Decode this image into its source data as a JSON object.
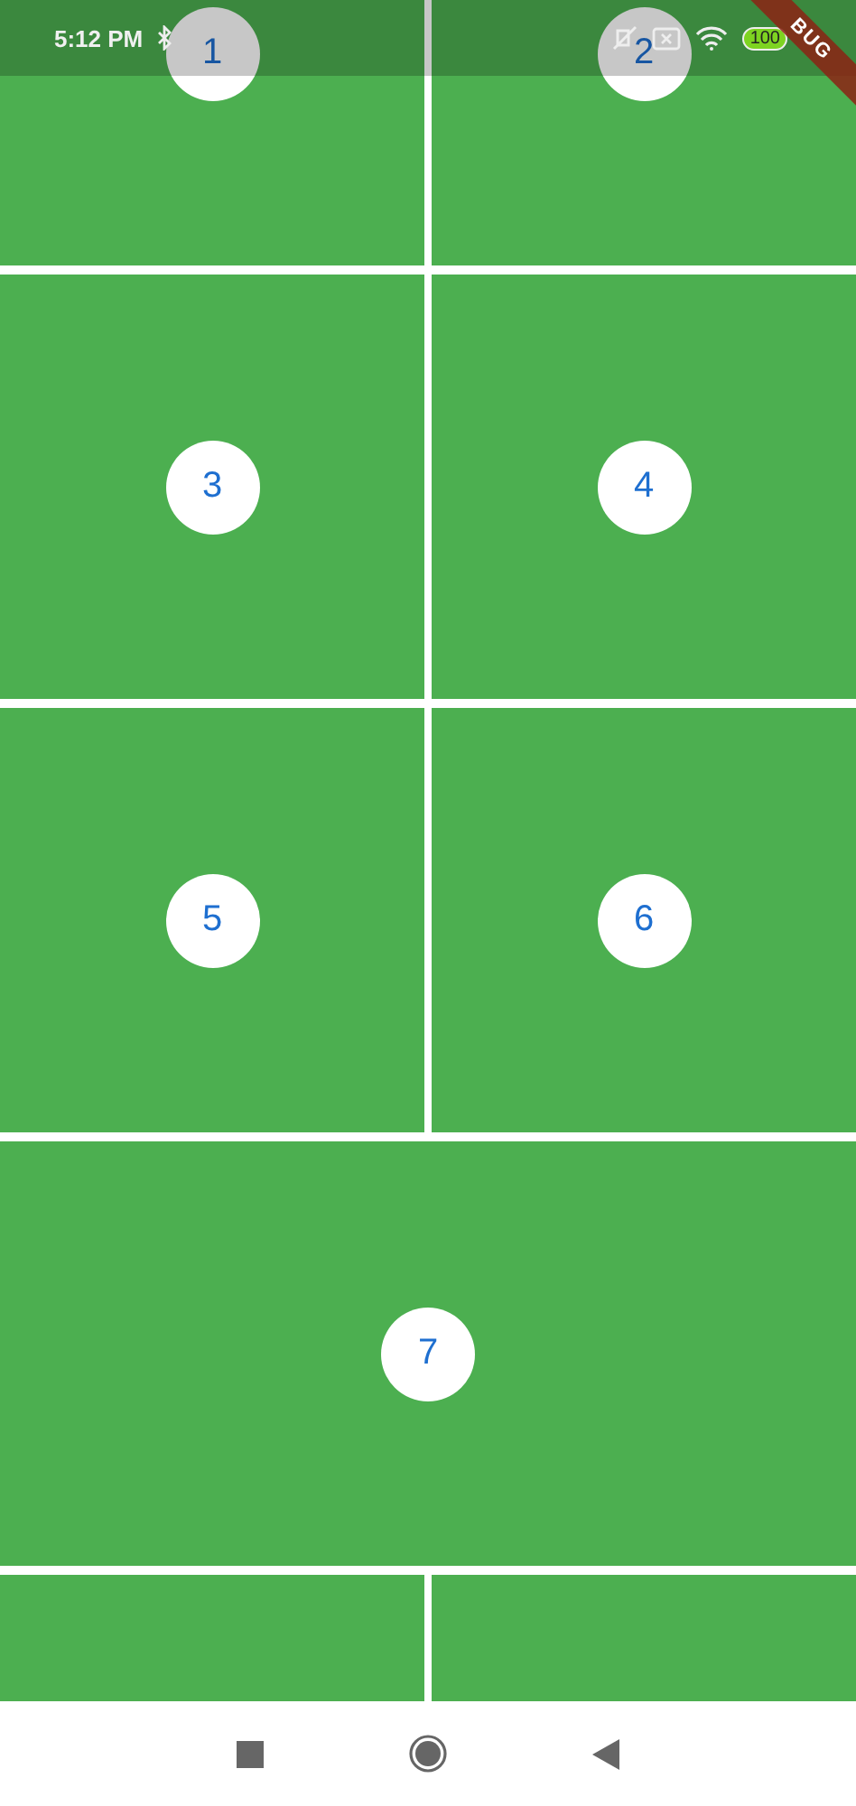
{
  "status_bar": {
    "time": "5:12 PM",
    "battery": "100"
  },
  "debug_banner": {
    "text": "BUG"
  },
  "tiles": [
    {
      "kind": "half",
      "label": "1"
    },
    {
      "kind": "half",
      "label": "2"
    },
    {
      "kind": "half",
      "label": "3"
    },
    {
      "kind": "half",
      "label": "4"
    },
    {
      "kind": "half",
      "label": "5"
    },
    {
      "kind": "half",
      "label": "6"
    },
    {
      "kind": "full",
      "label": "7"
    },
    {
      "kind": "half"
    },
    {
      "kind": "half"
    }
  ]
}
